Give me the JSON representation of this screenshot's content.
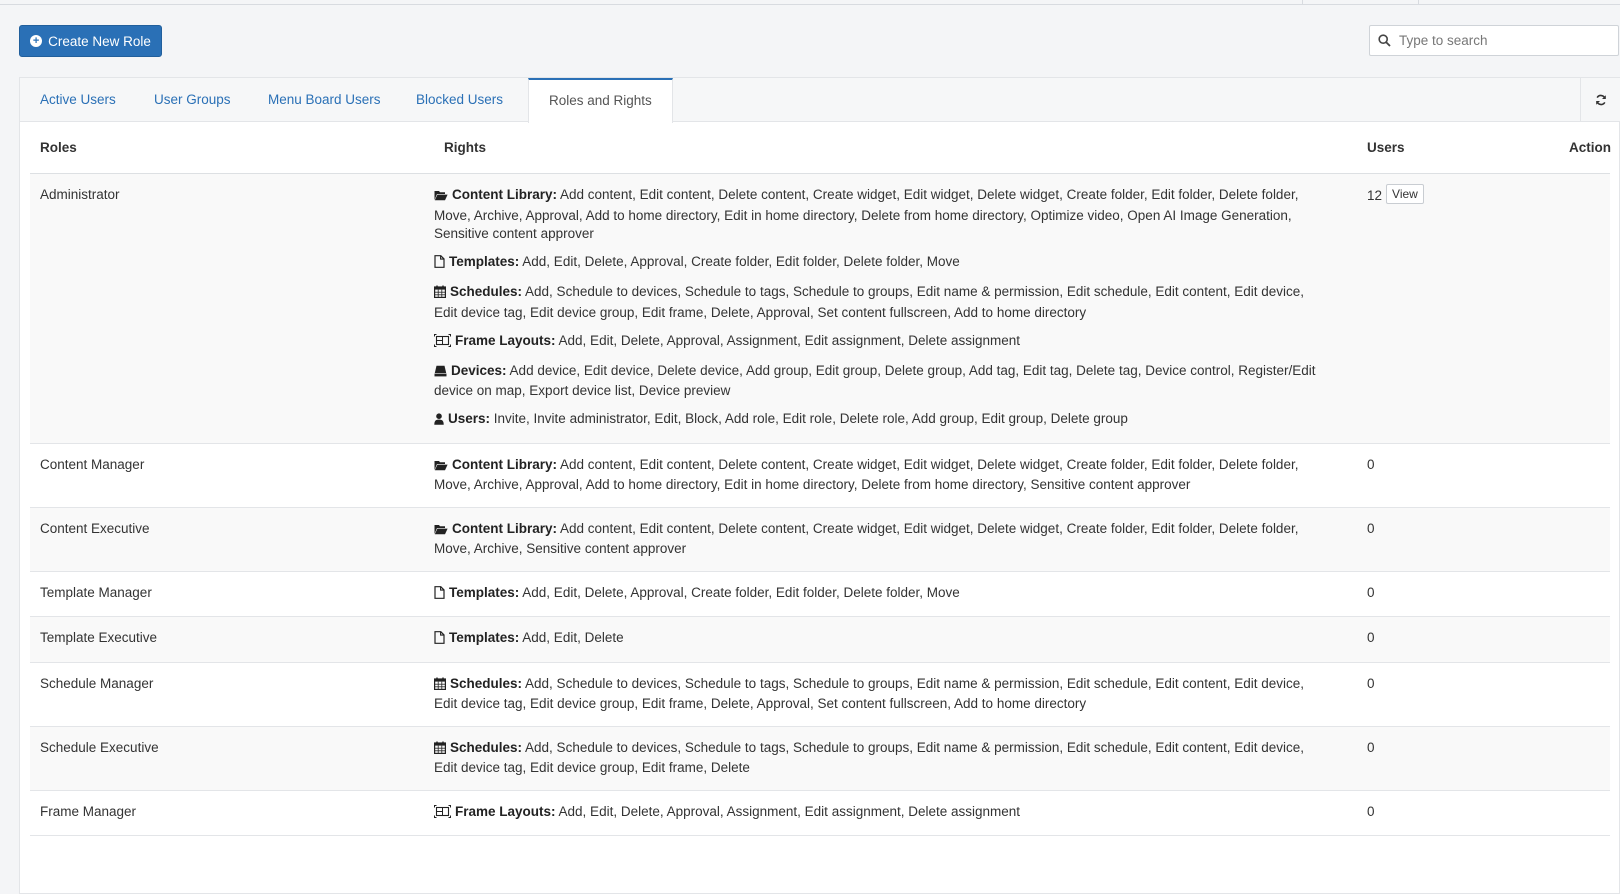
{
  "toolbar": {
    "create_label": "Create New Role",
    "search_placeholder": "Type to search"
  },
  "tabs": [
    {
      "label": "Active Users",
      "active": false
    },
    {
      "label": "User Groups",
      "active": false
    },
    {
      "label": "Menu Board Users",
      "active": false
    },
    {
      "label": "Blocked Users",
      "active": false
    },
    {
      "label": "Roles and Rights",
      "active": true
    }
  ],
  "table": {
    "headers": {
      "roles": "Roles",
      "rights": "Rights",
      "users": "Users",
      "action": "Action"
    },
    "view_label": "View",
    "rows": [
      {
        "role": "Administrator",
        "users": "12",
        "has_view": true,
        "rights": [
          {
            "icon": "folder-open-icon",
            "label": "Content Library:",
            "text": " Add content, Edit content, Delete content, Create widget, Edit widget, Delete widget, Create folder, Edit folder, Delete folder, Move, Archive, Approval, Add to home directory, Edit in home directory, Delete from home directory, Optimize video, Open AI Image Generation, Sensitive content approver"
          },
          {
            "icon": "file-icon",
            "label": "Templates:",
            "text": " Add, Edit, Delete, Approval, Create folder, Edit folder, Delete folder, Move"
          },
          {
            "icon": "calendar-icon",
            "label": "Schedules:",
            "text": " Add, Schedule to devices, Schedule to tags, Schedule to groups, Edit name & permission, Edit schedule, Edit content, Edit device, Edit device tag, Edit device group, Edit frame, Delete, Approval, Set content fullscreen, Add to home directory"
          },
          {
            "icon": "frame-layout-icon",
            "label": "Frame Layouts:",
            "text": " Add, Edit, Delete, Approval, Assignment, Edit assignment, Delete assignment"
          },
          {
            "icon": "device-icon",
            "label": "Devices:",
            "text": " Add device, Edit device, Delete device, Add group, Edit group, Delete group, Add tag, Edit tag, Delete tag, Device control, Register/Edit device on map, Export device list, Device preview"
          },
          {
            "icon": "user-icon",
            "label": "Users:",
            "text": " Invite, Invite administrator, Edit, Block, Add role, Edit role, Delete role, Add group, Edit group, Delete group"
          }
        ]
      },
      {
        "role": "Content Manager",
        "users": "0",
        "has_view": false,
        "rights": [
          {
            "icon": "folder-open-icon",
            "label": "Content Library:",
            "text": " Add content, Edit content, Delete content, Create widget, Edit widget, Delete widget, Create folder, Edit folder, Delete folder, Move, Archive, Approval, Add to home directory, Edit in home directory, Delete from home directory, Sensitive content approver"
          }
        ]
      },
      {
        "role": "Content Executive",
        "users": "0",
        "has_view": false,
        "rights": [
          {
            "icon": "folder-open-icon",
            "label": "Content Library:",
            "text": " Add content, Edit content, Delete content, Create widget, Edit widget, Delete widget, Create folder, Edit folder, Delete folder, Move, Archive, Sensitive content approver"
          }
        ]
      },
      {
        "role": "Template Manager",
        "users": "0",
        "has_view": false,
        "rights": [
          {
            "icon": "file-icon",
            "label": "Templates:",
            "text": " Add, Edit, Delete, Approval, Create folder, Edit folder, Delete folder, Move"
          }
        ]
      },
      {
        "role": "Template Executive",
        "users": "0",
        "has_view": false,
        "rights": [
          {
            "icon": "file-icon",
            "label": "Templates:",
            "text": " Add, Edit, Delete"
          }
        ]
      },
      {
        "role": "Schedule Manager",
        "users": "0",
        "has_view": false,
        "rights": [
          {
            "icon": "calendar-icon",
            "label": "Schedules:",
            "text": " Add, Schedule to devices, Schedule to tags, Schedule to groups, Edit name & permission, Edit schedule, Edit content, Edit device, Edit device tag, Edit device group, Edit frame, Delete, Approval, Set content fullscreen, Add to home directory"
          }
        ]
      },
      {
        "role": "Schedule Executive",
        "users": "0",
        "has_view": false,
        "rights": [
          {
            "icon": "calendar-icon",
            "label": "Schedules:",
            "text": " Add, Schedule to devices, Schedule to tags, Schedule to groups, Edit name & permission, Edit schedule, Edit content, Edit device, Edit device tag, Edit device group, Edit frame, Delete"
          }
        ]
      },
      {
        "role": "Frame Manager",
        "users": "0",
        "has_view": false,
        "rights": [
          {
            "icon": "frame-layout-icon",
            "label": "Frame Layouts:",
            "text": " Add, Edit, Delete, Approval, Assignment, Edit assignment, Delete assignment"
          }
        ]
      }
    ]
  }
}
